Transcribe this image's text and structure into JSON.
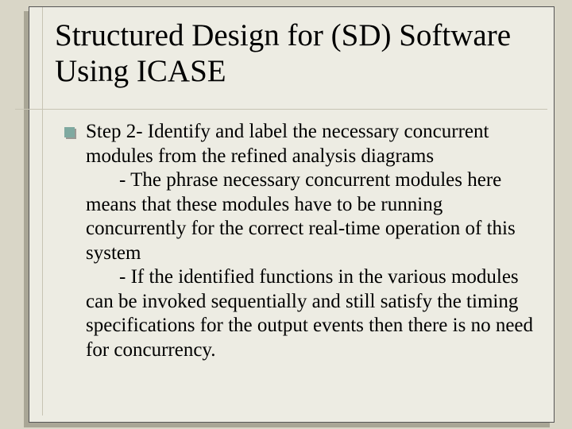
{
  "title": "Structured Design for (SD) Software Using ICASE",
  "bullet": {
    "main": "Step 2- Identify and label the necessary concurrent modules from the refined analysis diagrams",
    "sub1": "- The phrase necessary concurrent modules here means that these modules have to be running concurrently for the correct real-time operation of this system",
    "sub2": "- If the identified functions in the various modules can be invoked sequentially and still satisfy the timing specifications for the output events then there is no need for concurrency."
  },
  "colors": {
    "slide_bg": "#edece3",
    "page_bg": "#d9d6c7",
    "bullet_marker": "#7fa9a0"
  }
}
